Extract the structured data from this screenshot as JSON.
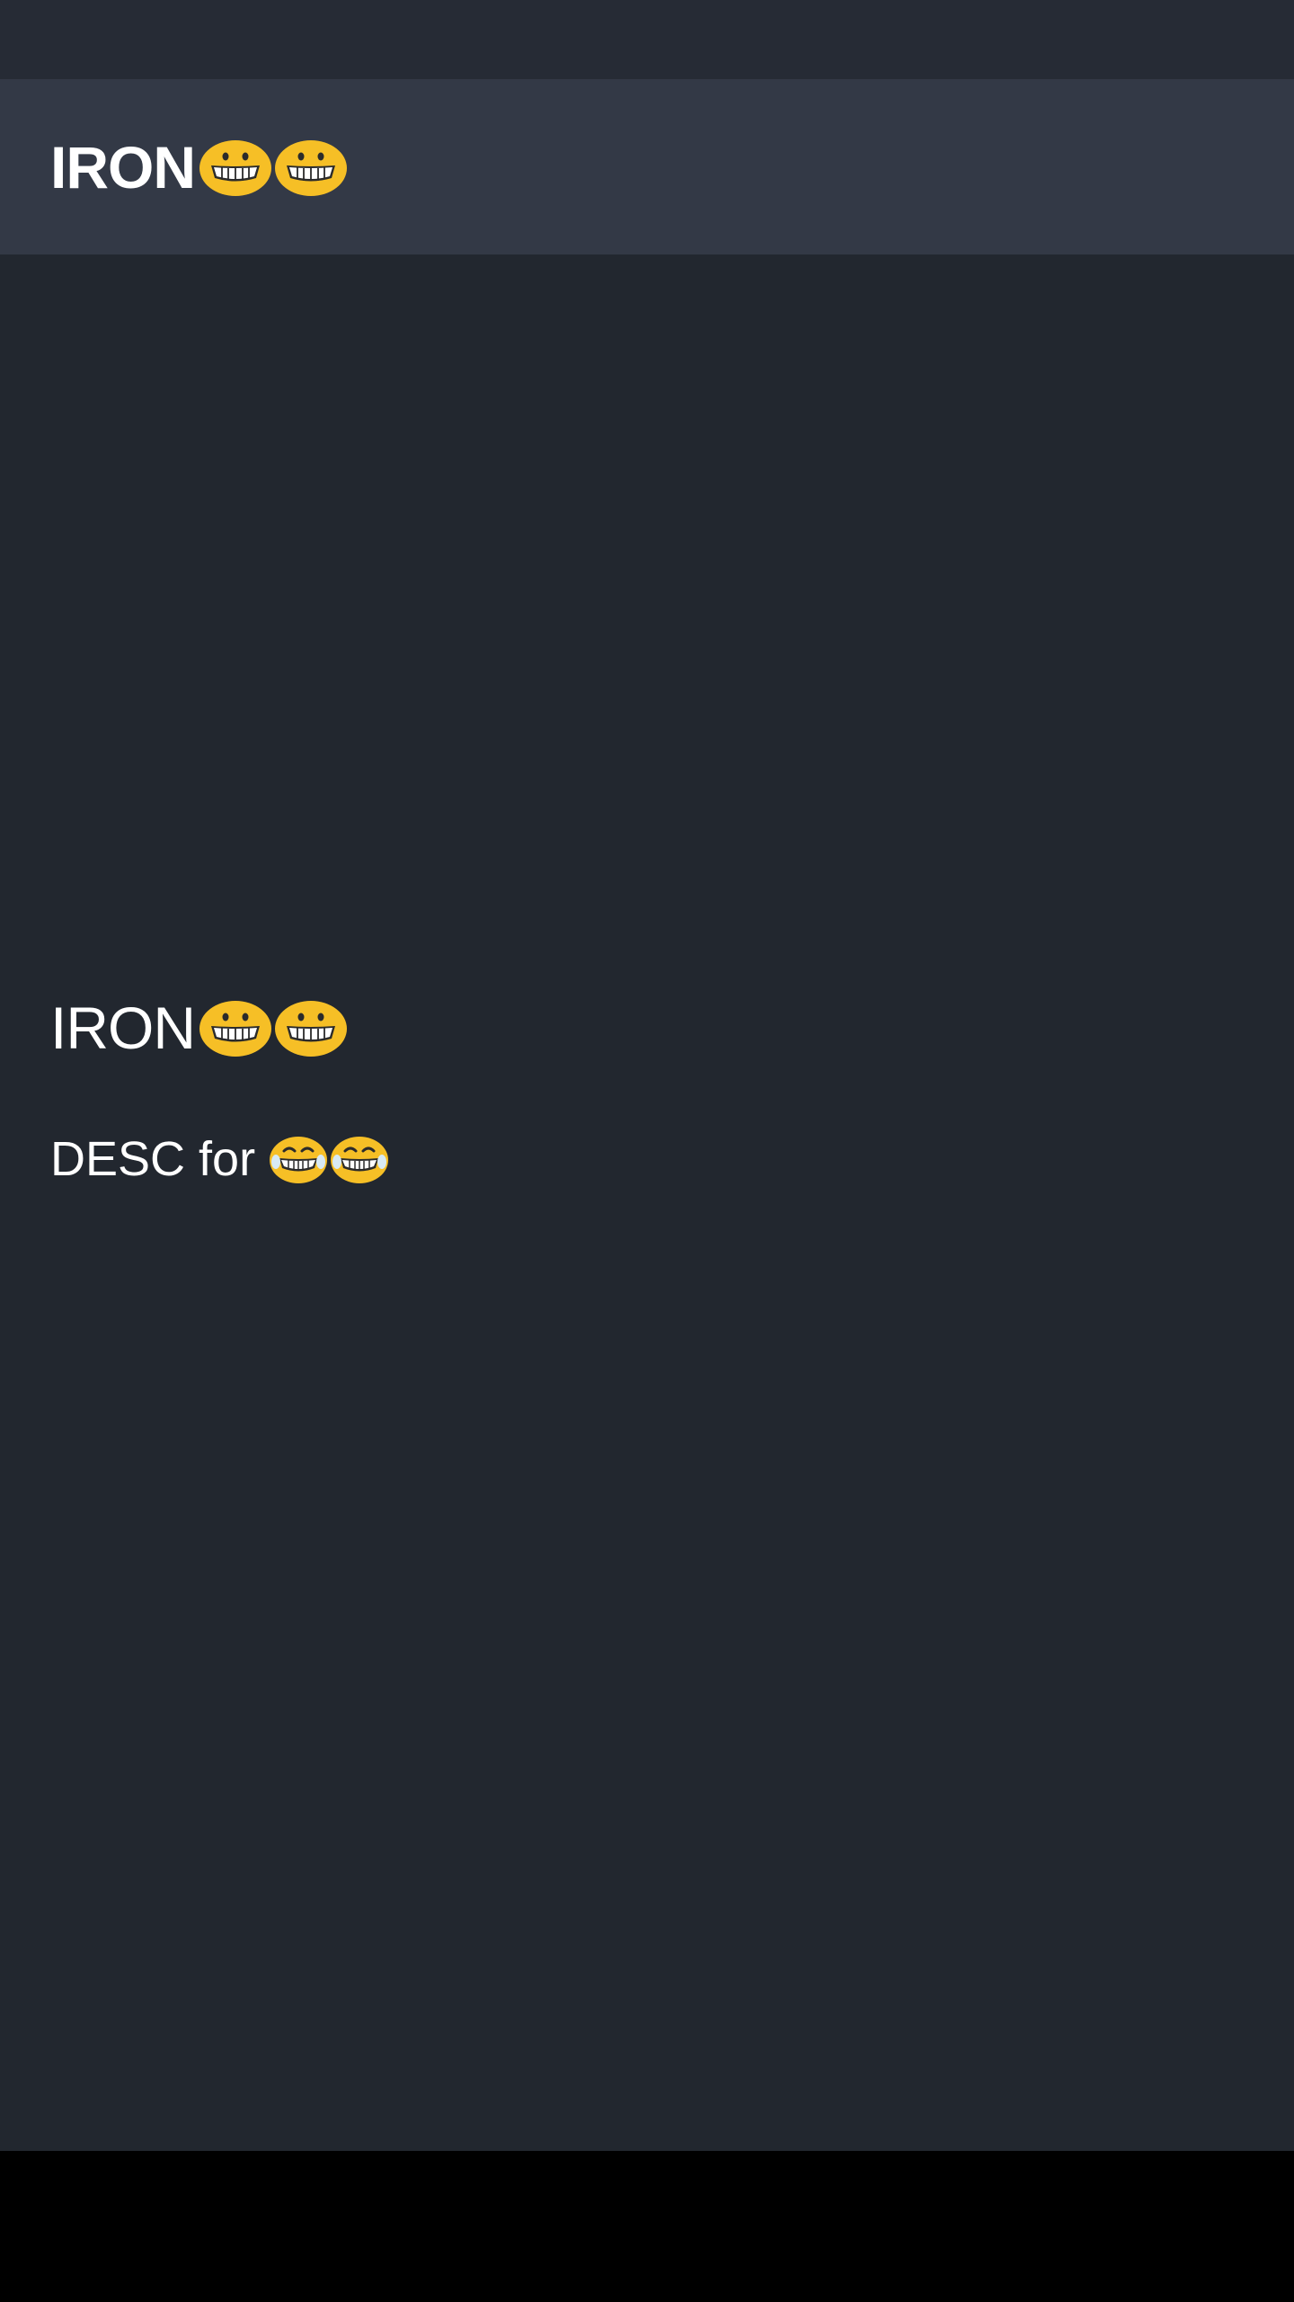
{
  "app_bar": {
    "title": "IRON",
    "title_emojis": [
      "grinning-face-icon",
      "grinning-face-icon"
    ]
  },
  "item": {
    "title": "IRON",
    "title_emojis": [
      "grinning-face-icon",
      "grinning-face-icon"
    ],
    "description": "DESC for",
    "description_emojis": [
      "tears-of-joy-face-icon",
      "tears-of-joy-face-icon"
    ]
  },
  "colors": {
    "status_bar": "#262b35",
    "app_bar": "#333946",
    "background": "#22272f",
    "nav_bar": "#000000",
    "text": "#ffffff",
    "emoji_yellow": "#f6bf26"
  }
}
